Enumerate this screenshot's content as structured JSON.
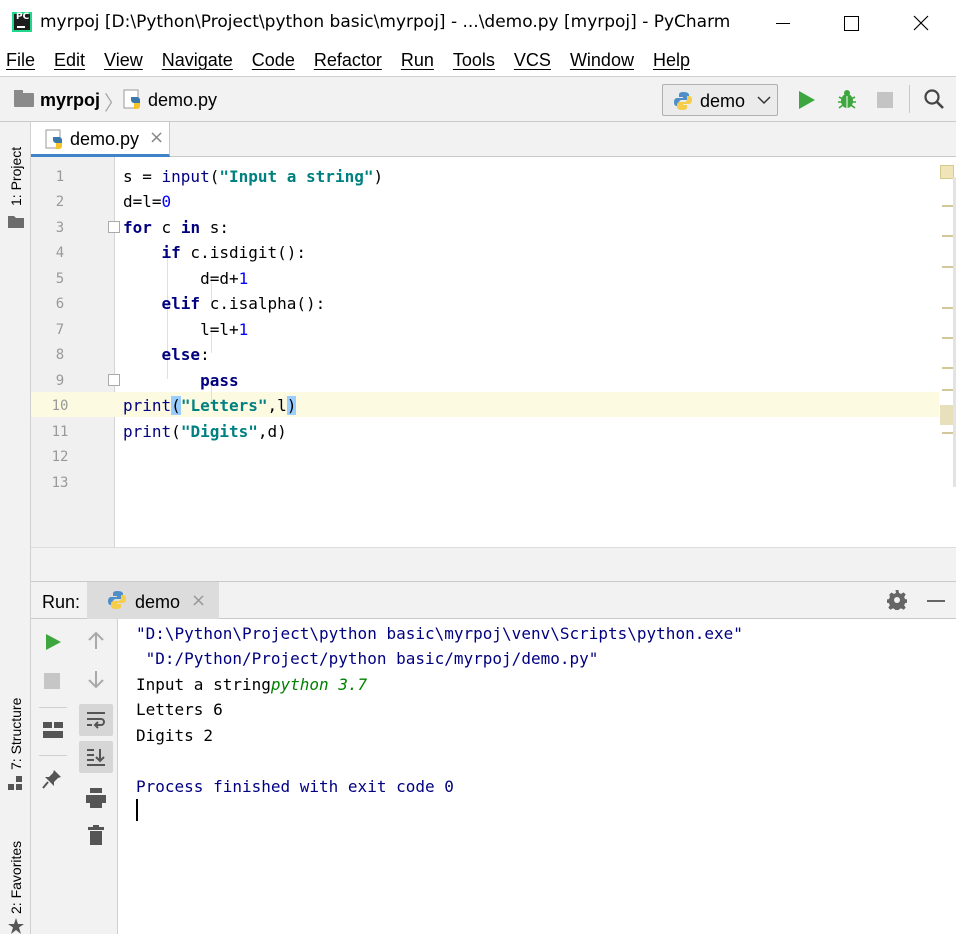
{
  "window": {
    "title": "myrpoj [D:\\Python\\Project\\python basic\\myrpoj] - ...\\demo.py [myrpoj] - PyCharm",
    "app_icon_text": "PC"
  },
  "menu": [
    "File",
    "Edit",
    "View",
    "Navigate",
    "Code",
    "Refactor",
    "Run",
    "Tools",
    "VCS",
    "Window",
    "Help"
  ],
  "navbar": {
    "project": "myrpoj",
    "file": "demo.py",
    "run_config": "demo"
  },
  "left_stripe": {
    "project": "1: Project",
    "structure": "7: Structure",
    "favorites": "2: Favorites"
  },
  "editor": {
    "tab_label": "demo.py",
    "tab_close": "×",
    "line_numbers": [
      "1",
      "2",
      "3",
      "4",
      "5",
      "6",
      "7",
      "8",
      "9",
      "10",
      "11",
      "12",
      "13"
    ],
    "lines": [
      "s = input(\"Input a string\")",
      "d=l=0",
      "for c in s:",
      "    if c.isdigit():",
      "        d=d+1",
      "    elif c.isalpha():",
      "        l=l+1",
      "    else:",
      "        pass",
      "print(\"Letters\",l)",
      "print(\"Digits\",d)",
      "",
      ""
    ],
    "caret_line": 10
  },
  "run_panel": {
    "label": "Run:",
    "tab": "demo",
    "tab_close": "×",
    "console": [
      "\"D:\\Python\\Project\\python basic\\myrpoj\\venv\\Scripts\\python.exe\"",
      " \"D:/Python/Project/python basic/myrpoj/demo.py\"",
      "Input a string",
      "python 3.7",
      "Letters 6",
      "Digits 2",
      "Process finished with exit code 0"
    ]
  },
  "colors": {
    "keyword": "#000080",
    "string": "#008080",
    "number": "#0000ff",
    "caret_row": "#fcfae1",
    "run_green": "#3ea63e"
  }
}
